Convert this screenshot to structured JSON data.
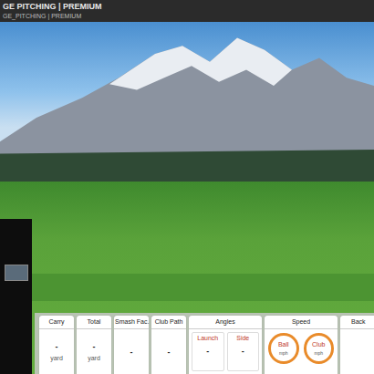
{
  "window": {
    "title": "GE PITCHING | PREMIUM",
    "subtitle": "GE_PITCHING | PREMIUM"
  },
  "stats": [
    {
      "label": "Carry",
      "value": "-",
      "unit": "yard"
    },
    {
      "label": "Total",
      "value": "-",
      "unit": "yard"
    },
    {
      "label": "Smash Fac.",
      "value": "-",
      "unit": ""
    },
    {
      "label": "Club Path",
      "value": "-",
      "unit": ""
    }
  ],
  "angles": {
    "label": "Angles",
    "items": [
      {
        "label": "Launch",
        "value": "-"
      },
      {
        "label": "Side",
        "value": "-"
      }
    ]
  },
  "speed": {
    "label": "Speed",
    "gauges": [
      {
        "label": "Ball",
        "unit": "mph"
      },
      {
        "label": "Club",
        "unit": "mph"
      }
    ]
  },
  "partial": {
    "label": "Back"
  }
}
